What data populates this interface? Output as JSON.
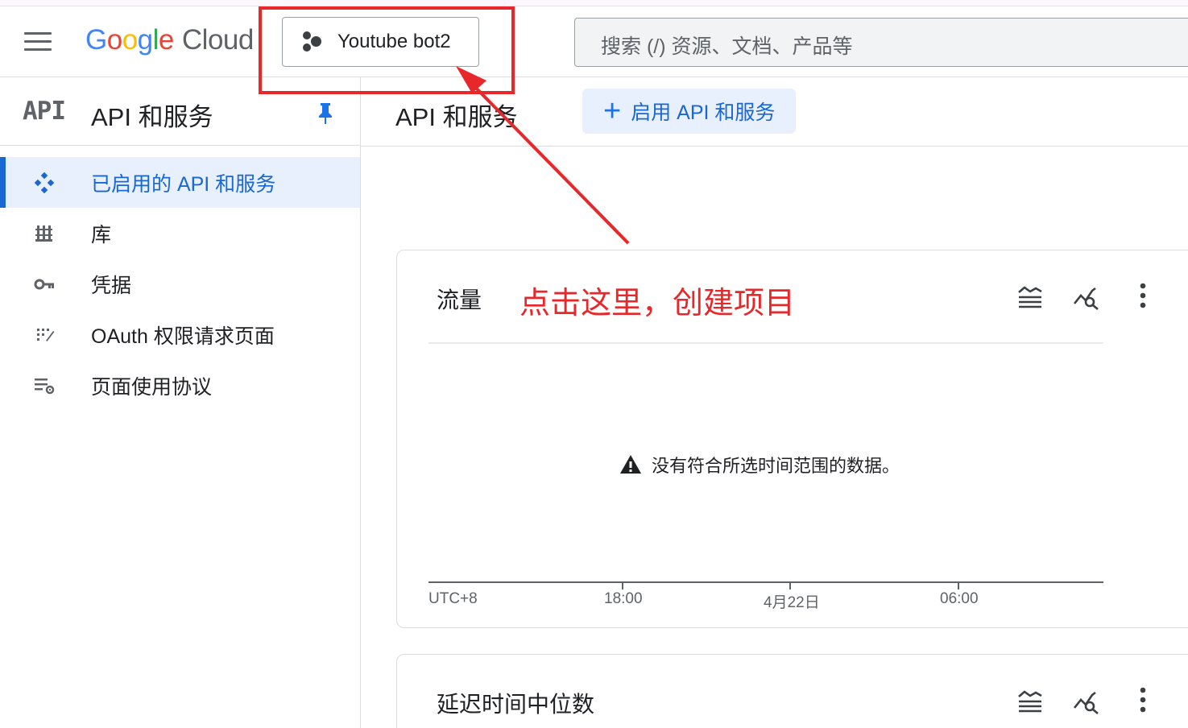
{
  "header": {
    "logo": {
      "g": "G",
      "o1": "o",
      "o2": "o",
      "g2": "g",
      "l": "l",
      "e": "e",
      "cloud": "Cloud"
    },
    "project_name": "Youtube bot2",
    "search_placeholder": "搜索 (/) 资源、文档、产品等"
  },
  "sidebar": {
    "badge": "API",
    "title": "API 和服务",
    "items": [
      {
        "label": "已启用的 API 和服务",
        "icon": "enabled-apis-icon",
        "active": true
      },
      {
        "label": "库",
        "icon": "library-icon",
        "active": false
      },
      {
        "label": "凭据",
        "icon": "key-icon",
        "active": false
      },
      {
        "label": "OAuth 权限请求页面",
        "icon": "oauth-consent-icon",
        "active": false
      },
      {
        "label": "页面使用协议",
        "icon": "page-usage-agreements-icon",
        "active": false
      }
    ]
  },
  "main": {
    "title": "API 和服务",
    "enable_button": "启用 API 和服务",
    "traffic_card": {
      "title": "流量",
      "annotation": "点击这里，创建项目",
      "empty_message": "没有符合所选时间范围的数据。",
      "x_ticks": [
        "UTC+8",
        "18:00",
        "4月22日",
        "06:00"
      ]
    },
    "latency_card": {
      "title": "延迟时间中位数"
    }
  },
  "colors": {
    "accent": "#1a73e8",
    "active_bg": "#e8f0fe",
    "annotation_red": "#e8272a"
  }
}
